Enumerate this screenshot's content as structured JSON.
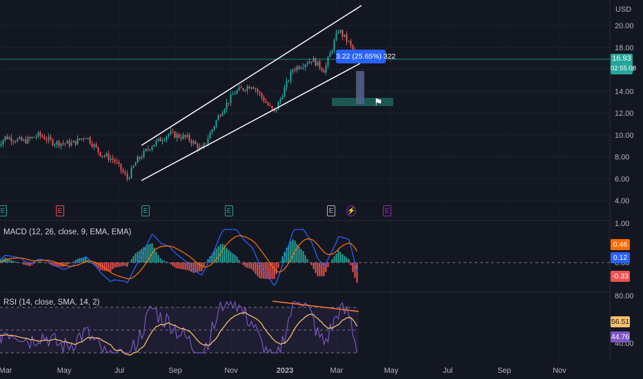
{
  "currency": "USD",
  "colors": {
    "background": "#131722",
    "up": "#26a69a",
    "down": "#ef5350",
    "macd_line": "#2962ff",
    "signal_line": "#ff6d00",
    "rsi_line": "#7e57c2",
    "rsi_ma": "#f7c06b",
    "channel": "#ffffff",
    "tooltip": "#2962ff",
    "divergence": "#ff7a30"
  },
  "price_axis": [
    "20.00",
    "18.00",
    "16.00",
    "14.00",
    "12.00",
    "10.00",
    "8.00",
    "6.00",
    "4.00"
  ],
  "macd_axis": [
    "1.00",
    "0.00"
  ],
  "rsi_axis": [
    "80.00",
    "40.00"
  ],
  "time_axis": [
    "Mar",
    "May",
    "Jul",
    "Sep",
    "Nov",
    "2023",
    "Mar",
    "May",
    "Jul",
    "Sep",
    "Nov"
  ],
  "last_price": {
    "value": "16.93",
    "countdown": "02:55:08"
  },
  "macd": {
    "title": "MACD (12, 26, close, 9, EMA, EMA)",
    "signal": "0.46",
    "macd": "0.12",
    "histogram": "-0.33"
  },
  "rsi": {
    "title": "RSI (14, close, SMA, 14, 2)",
    "ma": "56.51",
    "rsi": "44.76"
  },
  "measure_tooltip": "3.22 (25.65%) 322",
  "event_markers": [
    {
      "label": "E",
      "color": "#26a69a"
    },
    {
      "label": "E",
      "color": "#ef5350"
    },
    {
      "label": "E",
      "color": "#26a69a"
    },
    {
      "label": "E",
      "color": "#26a69a"
    },
    {
      "label": "E",
      "color": "#b2b5be"
    },
    {
      "label": "⚡",
      "color": "#9c27b0"
    },
    {
      "label": "E",
      "color": "#9c27b0"
    }
  ],
  "chart_data": {
    "type": "candlestick",
    "price_range": [
      4,
      20
    ],
    "channel": {
      "upper": [
        {
          "date": "2022-07-20",
          "price": 9.0
        },
        {
          "date": "2023-04-01",
          "price": 23.3
        }
      ],
      "lower": [
        {
          "date": "2022-07-20",
          "price": 5.8
        },
        {
          "date": "2023-03-24",
          "price": 16.2
        }
      ]
    },
    "price_path": [
      {
        "date": "2022-02-20",
        "price": 9.0
      },
      {
        "date": "2022-03-01",
        "price": 9.8
      },
      {
        "date": "2022-03-20",
        "price": 9.4
      },
      {
        "date": "2022-04-05",
        "price": 10.0
      },
      {
        "date": "2022-04-20",
        "price": 9.3
      },
      {
        "date": "2022-05-10",
        "price": 9.2
      },
      {
        "date": "2022-05-25",
        "price": 9.9
      },
      {
        "date": "2022-06-10",
        "price": 8.3
      },
      {
        "date": "2022-06-25",
        "price": 7.7
      },
      {
        "date": "2022-07-10",
        "price": 6.0
      },
      {
        "date": "2022-07-20",
        "price": 7.6
      },
      {
        "date": "2022-08-05",
        "price": 9.0
      },
      {
        "date": "2022-08-25",
        "price": 10.1
      },
      {
        "date": "2022-09-15",
        "price": 9.7
      },
      {
        "date": "2022-09-30",
        "price": 8.6
      },
      {
        "date": "2022-10-20",
        "price": 12.0
      },
      {
        "date": "2022-11-05",
        "price": 13.9
      },
      {
        "date": "2022-11-25",
        "price": 14.6
      },
      {
        "date": "2022-12-10",
        "price": 13.0
      },
      {
        "date": "2022-12-20",
        "price": 12.0
      },
      {
        "date": "2023-01-10",
        "price": 16.0
      },
      {
        "date": "2023-02-01",
        "price": 16.9
      },
      {
        "date": "2023-02-15",
        "price": 15.9
      },
      {
        "date": "2023-03-03",
        "price": 19.6
      },
      {
        "date": "2023-03-14",
        "price": 18.5
      },
      {
        "date": "2023-03-24",
        "price": 16.93
      }
    ]
  }
}
